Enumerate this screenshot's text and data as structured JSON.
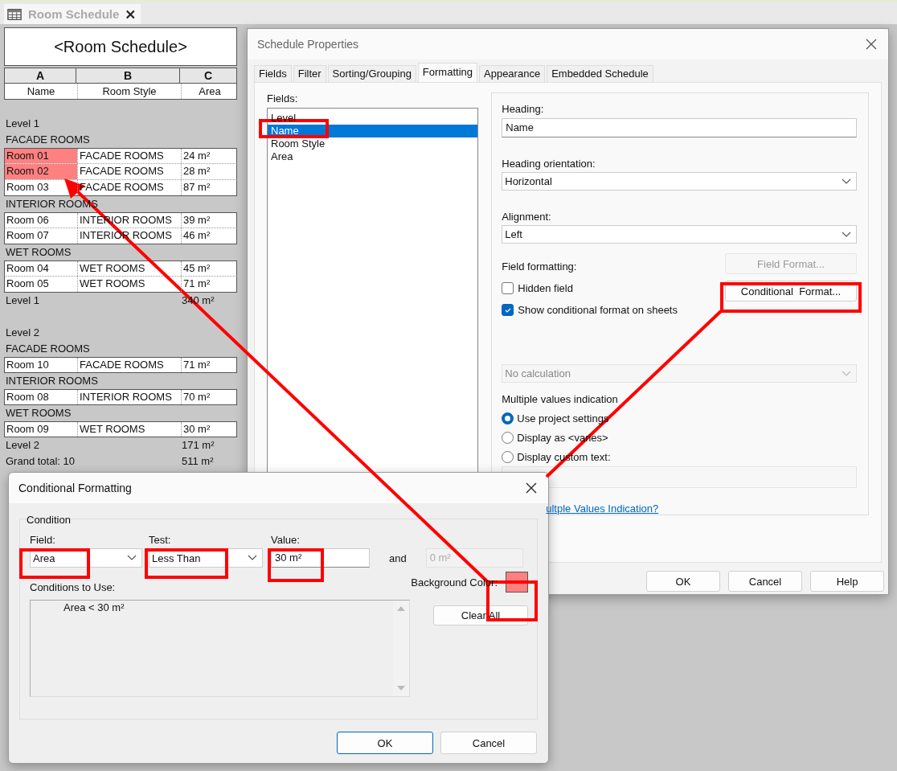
{
  "document_tab": {
    "title": "Room Schedule"
  },
  "schedule": {
    "title": "<Room Schedule>",
    "column_letters": [
      "A",
      "B",
      "C"
    ],
    "headers": [
      "Name",
      "Room Style",
      "Area"
    ],
    "rows": [
      {
        "kind": "level",
        "label": "Level 1"
      },
      {
        "kind": "group",
        "label": "FACADE ROOMS"
      },
      {
        "kind": "room",
        "cells": [
          "Room 01",
          "FACADE ROOMS",
          "24 m²"
        ],
        "highlighted": true
      },
      {
        "kind": "room",
        "cells": [
          "Room 02",
          "FACADE ROOMS",
          "28 m²"
        ],
        "highlighted": true
      },
      {
        "kind": "room",
        "cells": [
          "Room 03",
          "FACADE ROOMS",
          "87 m²"
        ],
        "highlighted": false
      },
      {
        "kind": "group",
        "label": "INTERIOR ROOMS"
      },
      {
        "kind": "room",
        "cells": [
          "Room 06",
          "INTERIOR ROOMS",
          "39 m²"
        ],
        "highlighted": false
      },
      {
        "kind": "room",
        "cells": [
          "Room 07",
          "INTERIOR ROOMS",
          "46 m²"
        ],
        "highlighted": false
      },
      {
        "kind": "group",
        "label": "WET ROOMS"
      },
      {
        "kind": "room",
        "cells": [
          "Room 04",
          "WET ROOMS",
          "45 m²"
        ],
        "highlighted": false
      },
      {
        "kind": "room",
        "cells": [
          "Room 05",
          "WET ROOMS",
          "71 m²"
        ],
        "highlighted": false
      },
      {
        "kind": "total",
        "label": "Level 1",
        "value": "340 m²"
      },
      {
        "kind": "level",
        "label": "Level 2"
      },
      {
        "kind": "group",
        "label": "FACADE ROOMS"
      },
      {
        "kind": "room",
        "cells": [
          "Room 10",
          "FACADE ROOMS",
          "71 m²"
        ],
        "highlighted": false
      },
      {
        "kind": "group",
        "label": "INTERIOR ROOMS"
      },
      {
        "kind": "room",
        "cells": [
          "Room 08",
          "INTERIOR ROOMS",
          "70 m²"
        ],
        "highlighted": false
      },
      {
        "kind": "group",
        "label": "WET ROOMS"
      },
      {
        "kind": "room",
        "cells": [
          "Room 09",
          "WET ROOMS",
          "30 m²"
        ],
        "highlighted": false
      },
      {
        "kind": "total",
        "label": "Level 2",
        "value": "171 m²"
      },
      {
        "kind": "total",
        "label": "Grand total: 10",
        "value": "511 m²"
      }
    ]
  },
  "schedule_properties": {
    "title": "Schedule Properties",
    "tabs": [
      {
        "label": "Fields",
        "selected": false
      },
      {
        "label": "Filter",
        "selected": false
      },
      {
        "label": "Sorting/Grouping",
        "selected": false
      },
      {
        "label": "Formatting",
        "selected": true
      },
      {
        "label": "Appearance",
        "selected": false
      },
      {
        "label": "Embedded Schedule",
        "selected": false
      }
    ],
    "fields_label": "Fields:",
    "fields": [
      {
        "label": "Level",
        "selected": false
      },
      {
        "label": "Name",
        "selected": true
      },
      {
        "label": "Room Style",
        "selected": false
      },
      {
        "label": "Area",
        "selected": false
      }
    ],
    "heading": {
      "label": "Heading:",
      "value": "Name"
    },
    "heading_orientation": {
      "label": "Heading orientation:",
      "value": "Horizontal"
    },
    "alignment": {
      "label": "Alignment:",
      "value": "Left"
    },
    "field_formatting_label": "Field formatting:",
    "field_format_button": {
      "label": "Field Format...",
      "disabled": true
    },
    "checkboxes": [
      {
        "label": "Hidden field",
        "checked": false
      },
      {
        "label": "Show conditional format on sheets",
        "checked": true
      }
    ],
    "conditional_format_button": {
      "label": "Conditional  Format...",
      "disabled": false
    },
    "calculation": {
      "value": "No calculation",
      "disabled": true
    },
    "multiple_values": {
      "label": "Multiple values indication",
      "options": [
        {
          "label": "Use project settings",
          "selected": true
        },
        {
          "label": "Display as <varies>",
          "selected": false
        },
        {
          "label": "Display custom text:",
          "selected": false
        }
      ]
    },
    "help_link": "ultple Values Indication?",
    "buttons": [
      "OK",
      "Cancel",
      "Help"
    ]
  },
  "conditional_formatting": {
    "title": "Conditional Formatting",
    "group_label": "Condition",
    "field": {
      "label": "Field:",
      "value": "Area"
    },
    "test": {
      "label": "Test:",
      "value": "Less Than"
    },
    "value": {
      "label": "Value:",
      "value": "30 m²"
    },
    "and_label": "and",
    "second_value": {
      "value": "0 m²",
      "disabled": true
    },
    "conditions_label": "Conditions to Use:",
    "conditions": [
      "Area < 30 m²"
    ],
    "background_color": {
      "label": "Background Color:",
      "color": "#ff8080"
    },
    "clear_button": "Clear All",
    "buttons": [
      {
        "label": "OK",
        "default": true
      },
      {
        "label": "Cancel",
        "default": false
      }
    ]
  }
}
